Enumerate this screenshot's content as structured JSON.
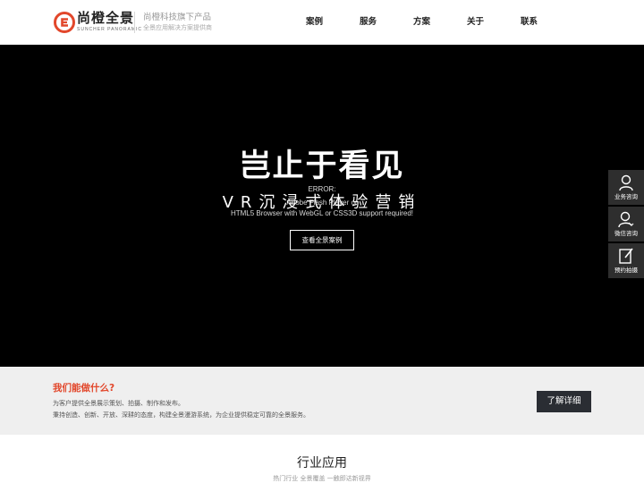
{
  "header": {
    "brand_cn": "尚橙全景",
    "brand_en": "SUNCHER PANORAMIC",
    "tagline_main": "尚橙科技旗下产品",
    "tagline_sub": "全景应用解决方案提供商",
    "brand_color": "#e2472b",
    "nav": [
      {
        "label": "案例"
      },
      {
        "label": "服务"
      },
      {
        "label": "方案"
      },
      {
        "label": "关于"
      },
      {
        "label": "联系"
      }
    ]
  },
  "hero": {
    "error_title": "ERROR:",
    "error_line1": "Adobe Flash Player or",
    "error_line2": "HTML5 Browser with WebGL or CSS3D support required!",
    "title": "岂止于看见",
    "subtitle": "VR沉浸式体验营销",
    "button": "查看全景案例"
  },
  "side_toolbar": [
    {
      "label": "业务咨询",
      "icon": "user-icon"
    },
    {
      "label": "微信咨询",
      "icon": "wechat-user-icon"
    },
    {
      "label": "预约拍摄",
      "icon": "edit-icon"
    }
  ],
  "band": {
    "title": "我们能做什么?",
    "line1": "为客户提供全景展示策划、拍摄、制作和发布。",
    "line2": "秉持创造、创新、开放、深耕的态度，构建全景漫游系统，为企业提供稳定可靠的全景服务。",
    "button": "了解详细",
    "title_color": "#e2472b"
  },
  "section": {
    "title": "行业应用",
    "subtitle": "热门行业 全景覆盖 一触即达新视界"
  }
}
